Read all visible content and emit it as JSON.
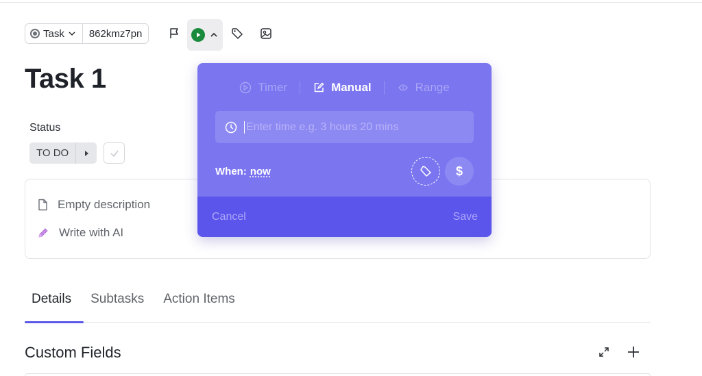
{
  "toolbar": {
    "type_label": "Task",
    "task_id": "862kmz7pn"
  },
  "task": {
    "title": "Task 1"
  },
  "status": {
    "label": "Status",
    "value": "TO DO"
  },
  "description": {
    "empty_label": "Empty description",
    "ai_label": "Write with AI"
  },
  "tabs": [
    {
      "label": "Details",
      "active": true
    },
    {
      "label": "Subtasks",
      "active": false
    },
    {
      "label": "Action Items",
      "active": false
    }
  ],
  "custom_fields": {
    "title": "Custom Fields"
  },
  "time_popup": {
    "modes": [
      {
        "label": "Timer",
        "active": false
      },
      {
        "label": "Manual",
        "active": true
      },
      {
        "label": "Range",
        "active": false
      }
    ],
    "input_placeholder": "Enter time e.g. 3 hours 20 mins",
    "when_label": "When:",
    "when_value": "now",
    "money_symbol": "$",
    "cancel_label": "Cancel",
    "save_label": "Save"
  },
  "colors": {
    "popup_bg": "#7b76f0",
    "popup_footer": "#5c55ec",
    "accent": "#5b57e8",
    "timer_green": "#1a8a3d"
  }
}
